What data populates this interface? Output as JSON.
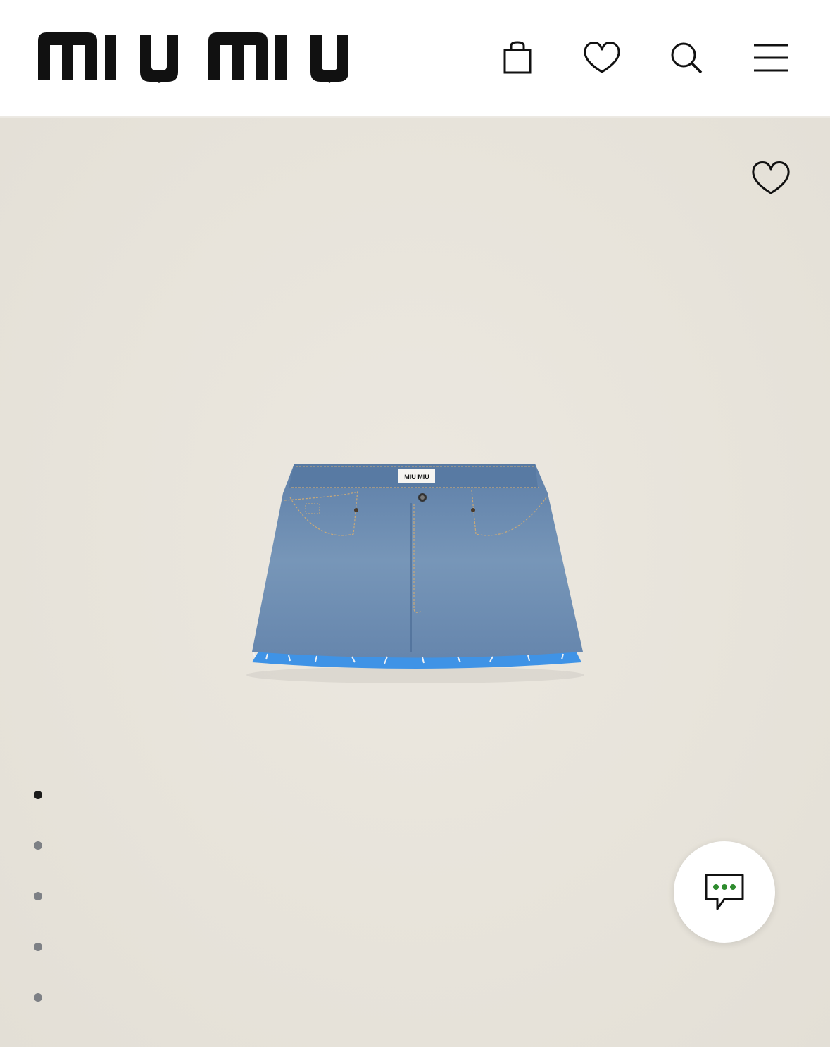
{
  "header": {
    "brand": "miu miu",
    "icons": {
      "bag": "shopping-bag-icon",
      "wishlist": "heart-icon",
      "search": "search-icon",
      "menu": "hamburger-menu-icon"
    }
  },
  "product": {
    "image_label": "MIU MIU",
    "favorite_icon": "heart-icon",
    "carousel": {
      "total": 5,
      "active_index": 0
    }
  },
  "chat": {
    "icon": "chat-bubble-icon",
    "accent_color": "#2e8b2e"
  },
  "colors": {
    "header_bg": "#ffffff",
    "page_bg": "#e8e4dc",
    "text": "#111111",
    "dot_inactive": "#7d8085",
    "dot_active": "#1a1a1a",
    "skirt_lining": "#3f93e6"
  }
}
